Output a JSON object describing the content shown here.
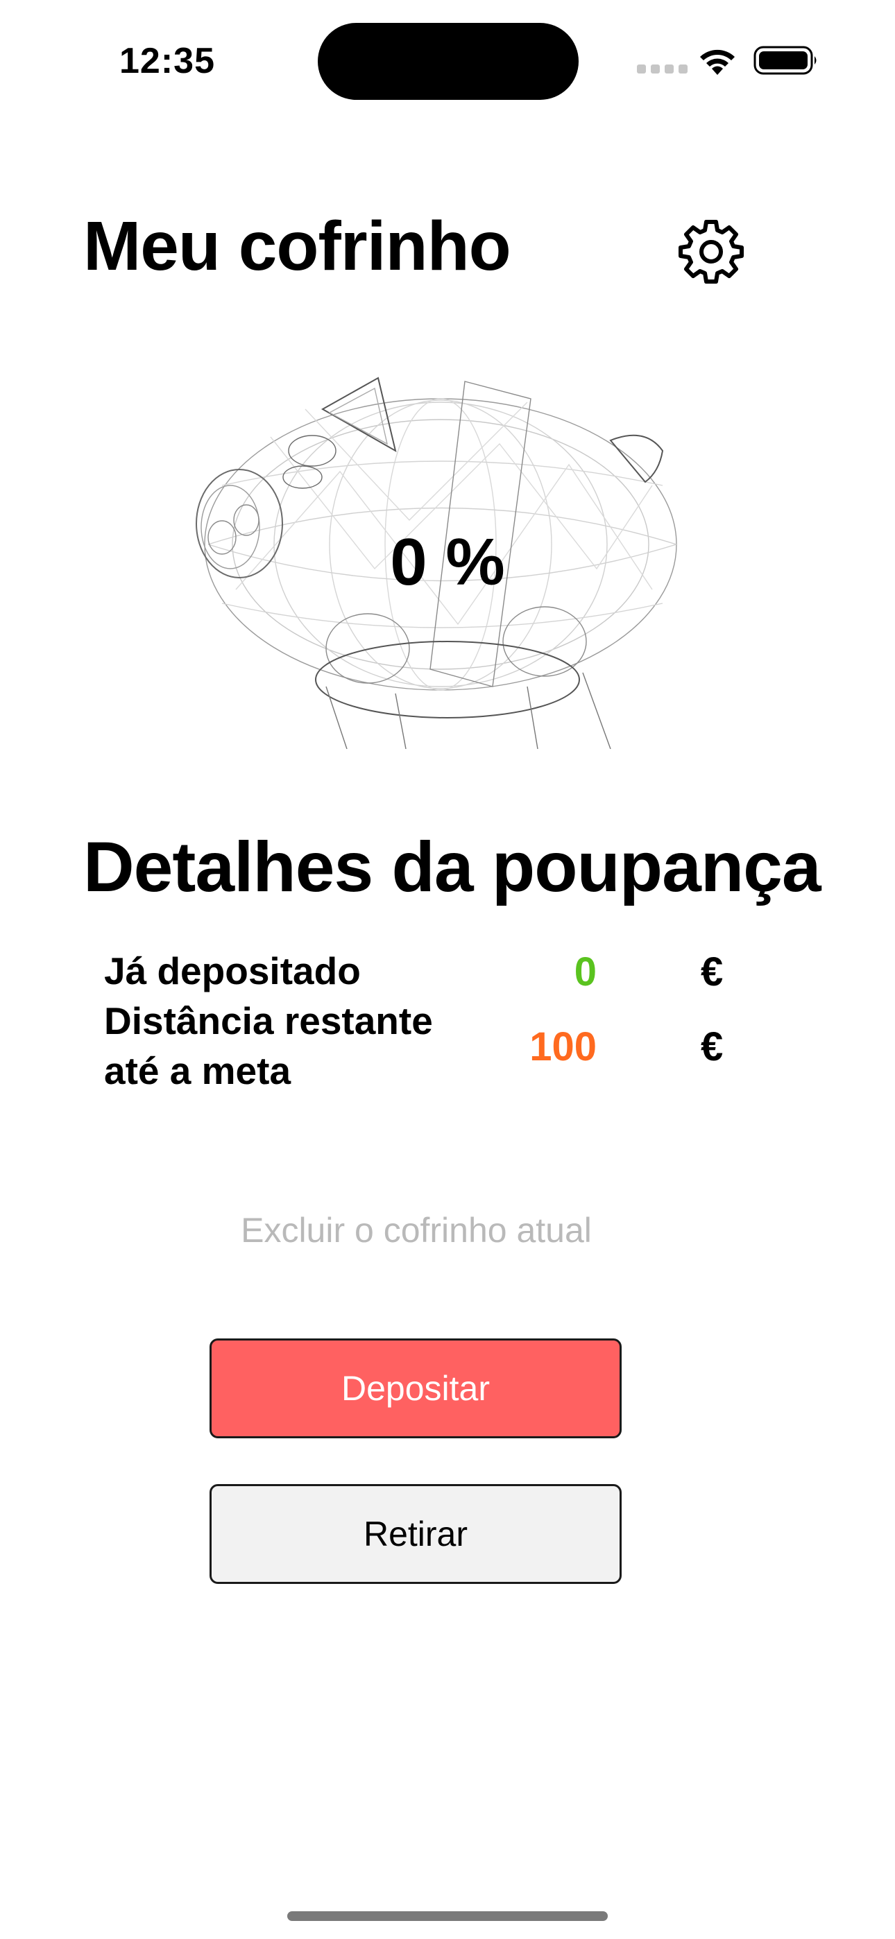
{
  "status_bar": {
    "time": "12:35"
  },
  "header": {
    "title": "Meu cofrinho"
  },
  "piggy": {
    "progress_label": "0 %"
  },
  "details": {
    "title": "Detalhes da poupança",
    "deposited": {
      "label": "Já depositado",
      "value": "0",
      "unit": "€",
      "color": "#5ac31f"
    },
    "remaining": {
      "label_line1": "Distância restante",
      "label_line2": "até a meta",
      "value": "100",
      "unit": "€",
      "color": "#ff6a1f"
    }
  },
  "actions": {
    "delete_label": "Excluir o cofrinho atual",
    "deposit_label": "Depositar",
    "withdraw_label": "Retirar"
  },
  "colors": {
    "deposit_button": "#ff6161",
    "withdraw_button": "#f2f2f2",
    "delete_link": "#b9b9b9"
  },
  "icons": {
    "settings": "gear-icon",
    "wifi": "wifi-icon",
    "battery": "battery-icon"
  }
}
